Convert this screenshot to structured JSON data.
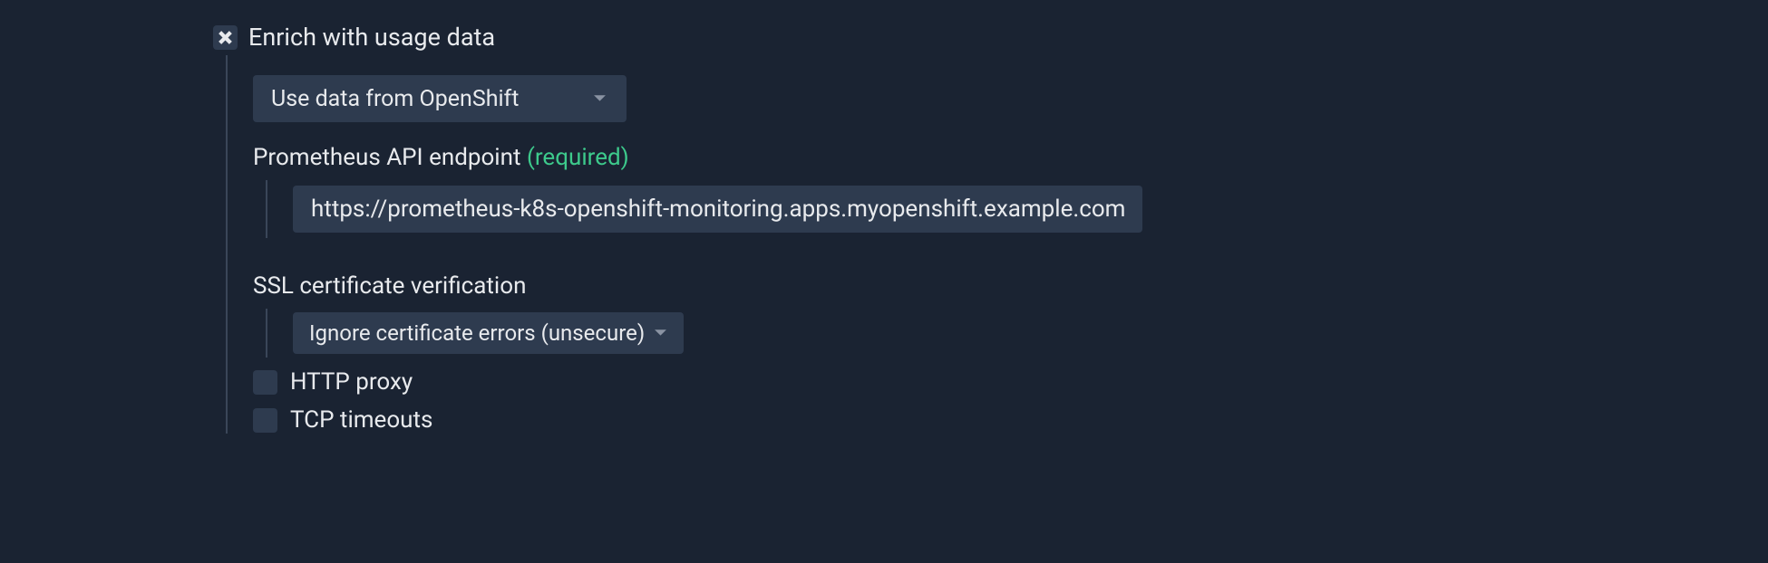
{
  "section": {
    "title": "Enrich with usage data",
    "checked": true
  },
  "dataSource": {
    "selected": "Use data from OpenShift"
  },
  "prometheusEndpoint": {
    "label": "Prometheus API endpoint",
    "requiredText": "(required)",
    "value": "https://prometheus-k8s-openshift-monitoring.apps.myopenshift.example.com"
  },
  "sslVerification": {
    "label": "SSL certificate verification",
    "selected": "Ignore certificate errors (unsecure)"
  },
  "options": {
    "httpProxy": {
      "label": "HTTP proxy",
      "checked": false
    },
    "tcpTimeouts": {
      "label": "TCP timeouts",
      "checked": false
    }
  }
}
